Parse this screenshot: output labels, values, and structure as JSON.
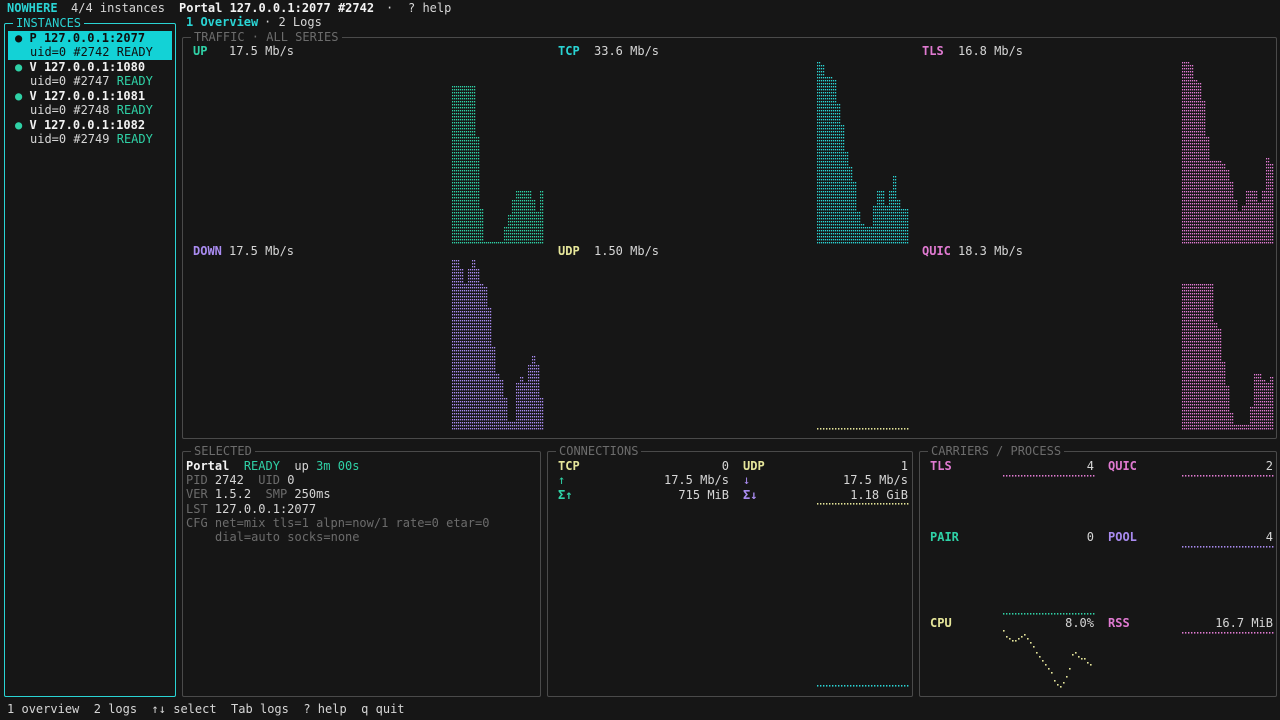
{
  "header": {
    "app": "NOWHERE",
    "instances_count": "4/4 instances",
    "portal": "Portal 127.0.0.1:2077 #2742",
    "sep": "·",
    "help": "? help"
  },
  "tabs": [
    {
      "label": "1 Overview"
    },
    {
      "label": "· 2 Logs"
    }
  ],
  "instances": {
    "title": "INSTANCES",
    "items": [
      {
        "dot": "●",
        "kind": "P",
        "addr": "127.0.0.1:2077",
        "uid": "uid=0 #2742",
        "status": "READY"
      },
      {
        "dot": "●",
        "kind": "V",
        "addr": "127.0.0.1:1080",
        "uid": "uid=0 #2747",
        "status": "READY"
      },
      {
        "dot": "●",
        "kind": "V",
        "addr": "127.0.0.1:1081",
        "uid": "uid=0 #2748",
        "status": "READY"
      },
      {
        "dot": "●",
        "kind": "V",
        "addr": "127.0.0.1:1082",
        "uid": "uid=0 #2749",
        "status": "READY"
      }
    ]
  },
  "traffic": {
    "title": "TRAFFIC · ALL SERIES",
    "series": [
      {
        "label": "UP",
        "value": "17.5 Mb/s",
        "color": "#2fd1a6"
      },
      {
        "label": "TCP",
        "value": "33.6 Mb/s",
        "color": "#2ad4d4"
      },
      {
        "label": "TLS",
        "value": "16.8 Mb/s",
        "color": "#e07ad1"
      },
      {
        "label": "DOWN",
        "value": "17.5 Mb/s",
        "color": "#a98bf0"
      },
      {
        "label": "UDP",
        "value": "1.50 Mb/s",
        "color": "#e6e69a"
      },
      {
        "label": "QUIC",
        "value": "18.3 Mb/s",
        "color": "#e07ad1"
      }
    ]
  },
  "selected": {
    "title": "SELECTED",
    "name": "Portal",
    "status": "READY",
    "up_label": "up",
    "uptime": "3m 00s",
    "pid_label": "PID",
    "pid": "2742",
    "uid_label": "UID",
    "uid": "0",
    "ver_label": "VER",
    "ver": "1.5.2",
    "smp_label": "SMP",
    "smp": "250ms",
    "lst_label": "LST",
    "lst": "127.0.0.1:2077",
    "cfg_label": "CFG",
    "cfg1": "net=mix tls=1 alpn=now/1 rate=0 etar=0",
    "cfg2": "dial=auto socks=none"
  },
  "connections": {
    "title": "CONNECTIONS",
    "tcp_label": "TCP",
    "tcp": "0",
    "udp_label": "UDP",
    "udp": "1",
    "up_arrow": "↑",
    "up_rate": "17.5 Mb/s",
    "down_arrow": "↓",
    "down_rate": "17.5 Mb/s",
    "sum_up_label": "Σ↑",
    "sum_up": "715 MiB",
    "sum_down_label": "Σ↓",
    "sum_down": "1.18 GiB"
  },
  "carriers": {
    "title": "CARRIERS / PROCESS",
    "tls_label": "TLS",
    "tls": "4",
    "quic_label": "QUIC",
    "quic": "2",
    "pair_label": "PAIR",
    "pair": "0",
    "pool_label": "POOL",
    "pool": "4",
    "cpu_label": "CPU",
    "cpu": "8.0%",
    "rss_label": "RSS",
    "rss": "16.7 MiB"
  },
  "footer": {
    "items": [
      {
        "key": "1",
        "label": "overview"
      },
      {
        "key": "2",
        "label": "logs"
      },
      {
        "key": "↑↓",
        "label": "select"
      },
      {
        "key": "Tab",
        "label": "logs"
      },
      {
        "key": "?",
        "label": "help"
      },
      {
        "key": "q",
        "label": "quit"
      }
    ]
  }
}
